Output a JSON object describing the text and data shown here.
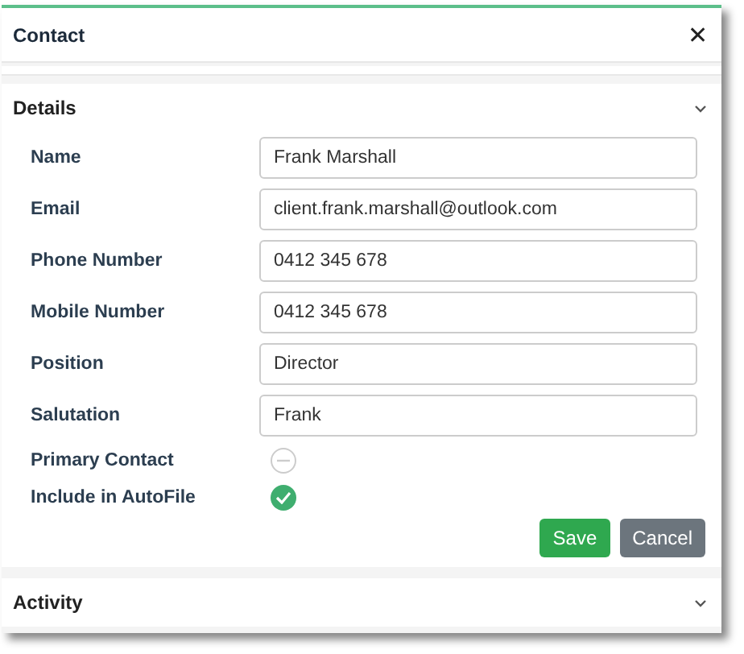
{
  "window": {
    "title": "Contact",
    "close": "✕"
  },
  "sections": [
    {
      "title": "Details"
    },
    {
      "title": "Activity"
    }
  ],
  "fields": [
    {
      "label": "Name",
      "value": "Frank Marshall"
    },
    {
      "label": "Email",
      "value": "client.frank.marshall@outlook.com"
    },
    {
      "label": "Phone Number",
      "value": "0412 345 678"
    },
    {
      "label": "Mobile Number",
      "value": "0412 345 678"
    },
    {
      "label": "Position",
      "value": "Director"
    },
    {
      "label": "Salutation",
      "value": "Frank"
    }
  ],
  "toggles": [
    {
      "label": "Primary Contact",
      "checked": false
    },
    {
      "label": "Include in AutoFile",
      "checked": true
    }
  ],
  "buttons": [
    {
      "label": "Save",
      "kind": "primary"
    },
    {
      "label": "Cancel",
      "kind": "secondary"
    }
  ]
}
